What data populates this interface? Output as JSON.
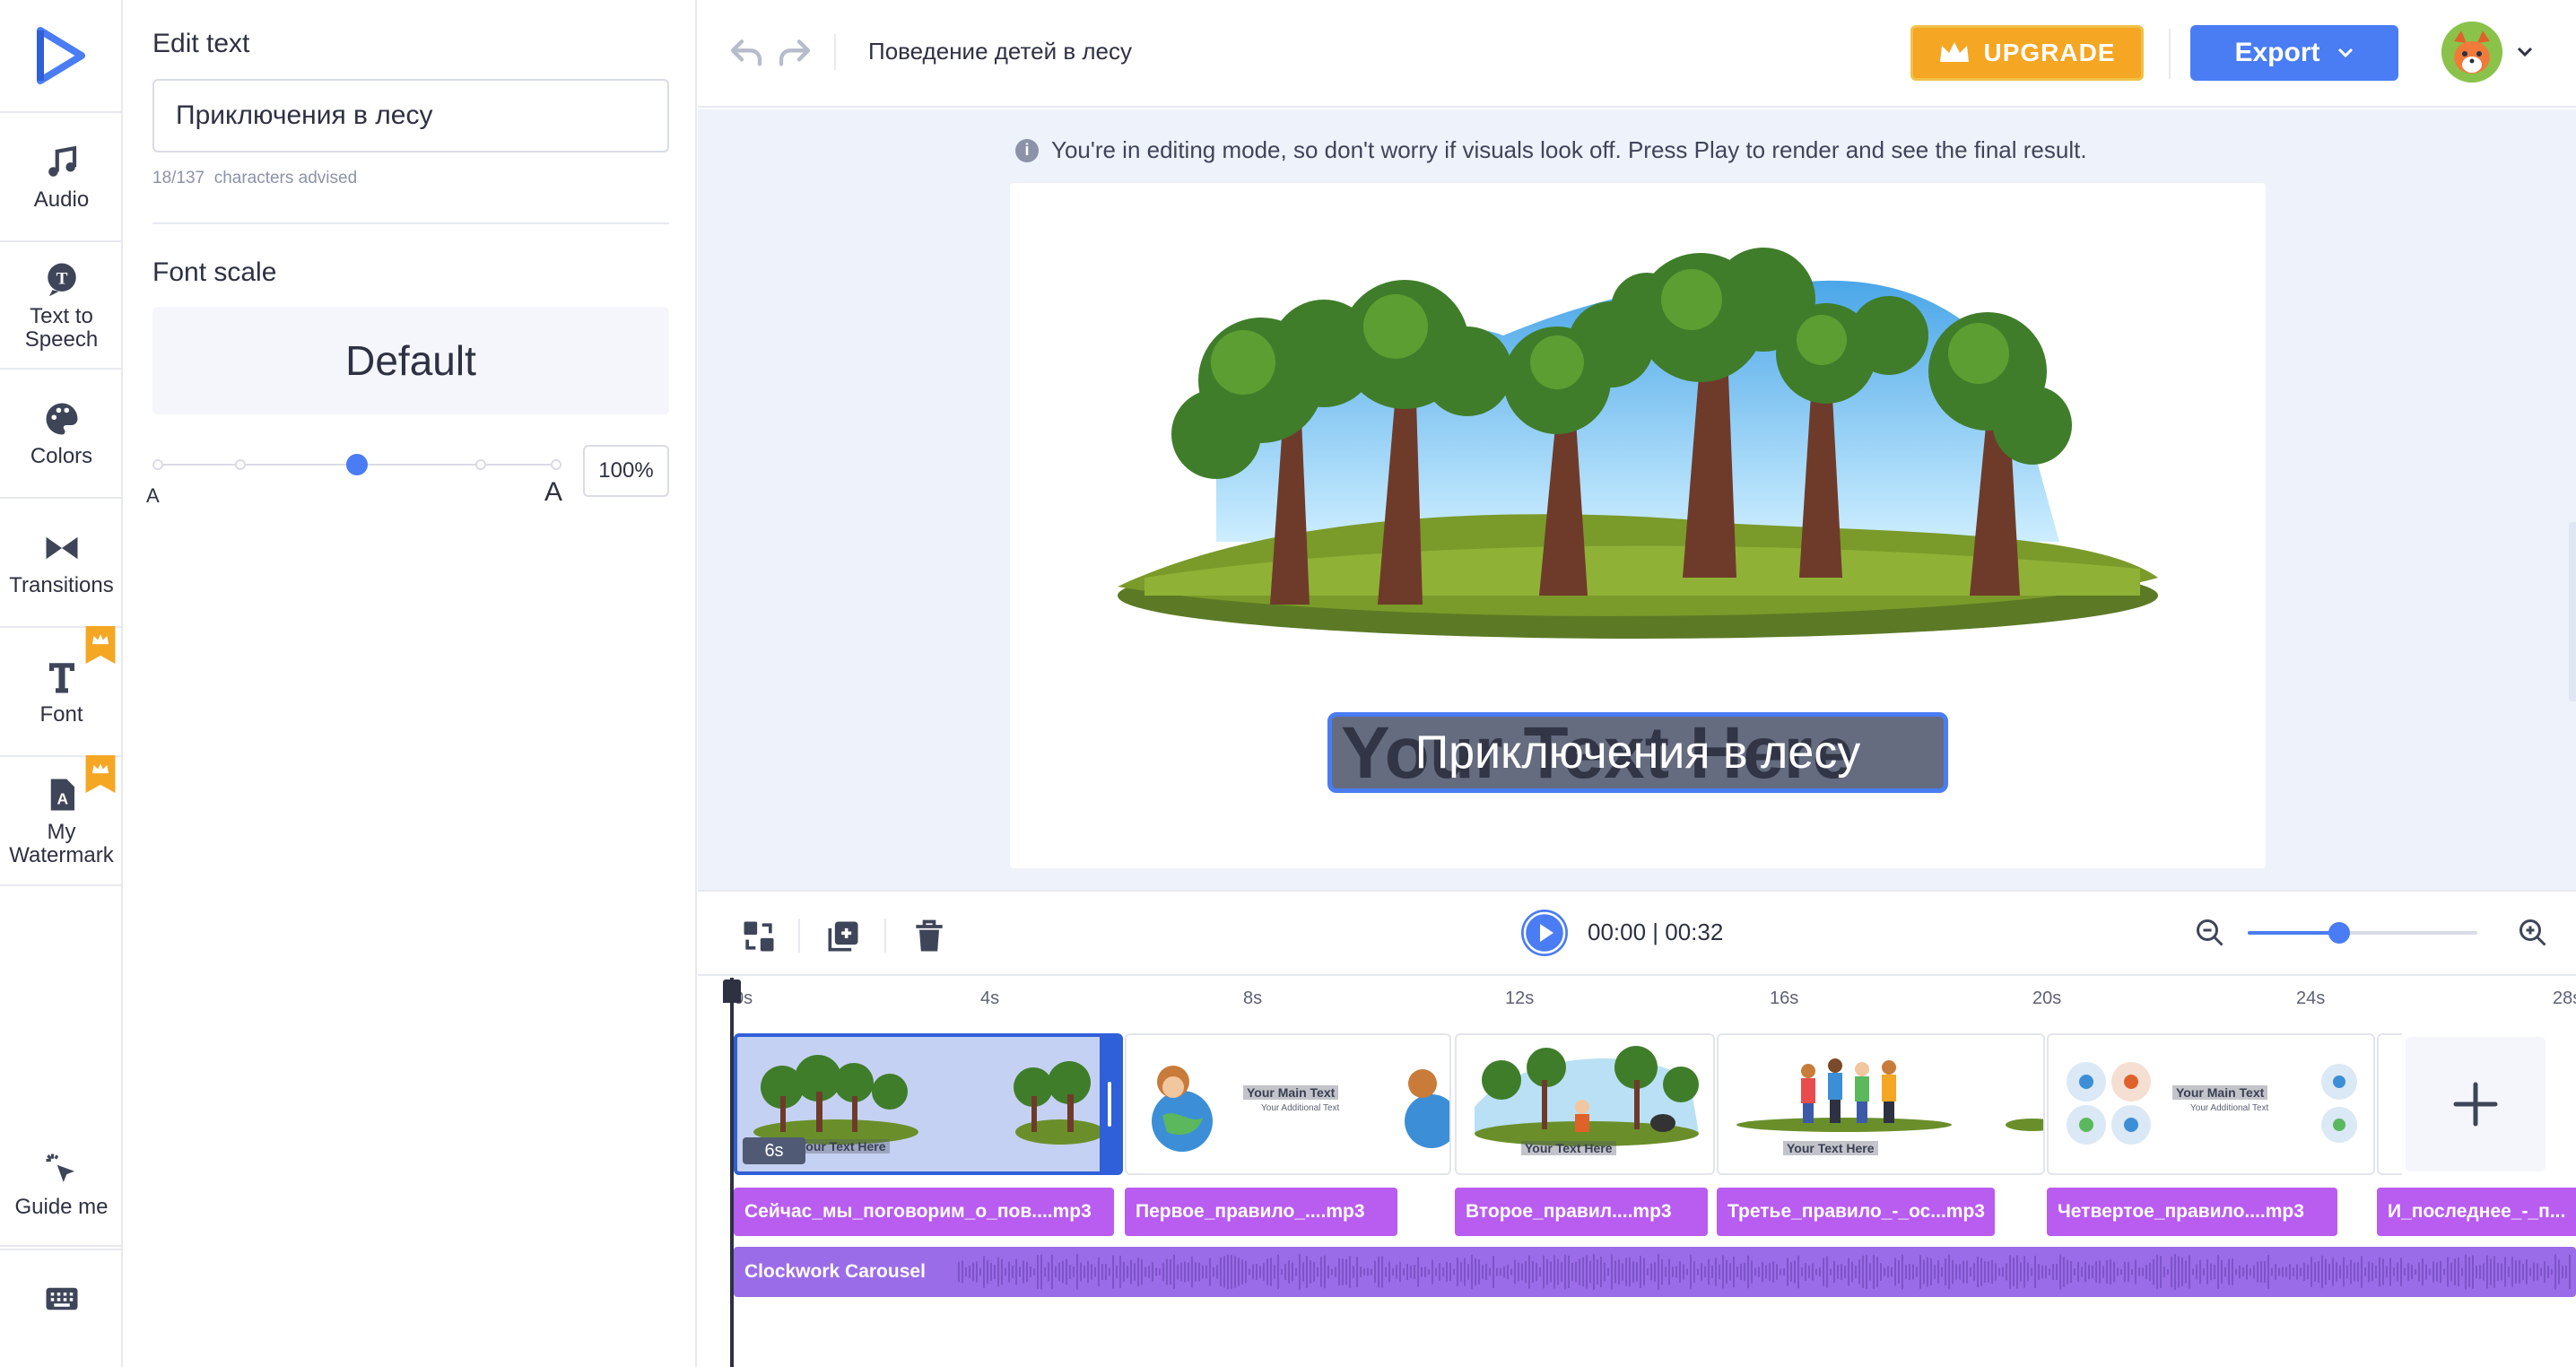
{
  "rail": {
    "items": [
      {
        "label": "Audio",
        "icon": "music-note-icon"
      },
      {
        "label": "Text to Speech",
        "icon": "speech-icon"
      },
      {
        "label": "Colors",
        "icon": "palette-icon"
      },
      {
        "label": "Transitions",
        "icon": "transitions-icon"
      },
      {
        "label": "Font",
        "icon": "font-icon",
        "premium": true
      },
      {
        "label": "My Watermark",
        "icon": "watermark-icon",
        "premium": true
      }
    ],
    "guide_label": "Guide me",
    "keyboard_icon": "keyboard-icon"
  },
  "edit_panel": {
    "title": "Edit text",
    "text_value": "Приключения в лесу",
    "char_count": "18/137",
    "char_hint": "characters advised",
    "font_scale_title": "Font scale",
    "font_scale_value": "Default",
    "scale_small": "A",
    "scale_large": "A",
    "scale_percent": "100%",
    "scale_level": 0.5
  },
  "header": {
    "project_title": "Поведение детей в лесу",
    "upgrade_label": "UPGRADE",
    "export_label": "Export"
  },
  "stage": {
    "notice": "You're in editing mode, so don't worry if visuals look off. Press Play to render and see the final result.",
    "ghost_text": "Your Text Here",
    "title_text": "Приключения в лесу"
  },
  "timeline": {
    "current_time": "00:00",
    "total_time": "00:32",
    "time_display": "00:00 | 00:32",
    "zoom_level": 0.4,
    "ruler_labels": [
      "0s",
      "4s",
      "8s",
      "12s",
      "16s",
      "20s",
      "24s",
      "28s"
    ],
    "scenes": [
      {
        "duration": "6s",
        "caption": "Your Text Here"
      },
      {
        "caption": "Your Main Text",
        "sub": "Your Additional Text"
      },
      {
        "caption": "Your Text Here"
      },
      {
        "caption": "Your Text Here"
      },
      {
        "caption": "Your Main Text",
        "sub": "Your Additional Text"
      }
    ],
    "audio_clips": [
      "Сейчас_мы_поговорим_о_пов....mp3",
      "Первое_правило_....mp3",
      "Второе_правил....mp3",
      "Третье_правило_-_ос...mp3",
      "Четвертое_правило....mp3",
      "И_последнее_-_п..."
    ],
    "music_track": "Clockwork Carousel"
  },
  "colors": {
    "accent": "#4a7cf3",
    "upgrade": "#f5a623",
    "audio_clip": "#b95cf0",
    "music": "#9b6ce8"
  }
}
